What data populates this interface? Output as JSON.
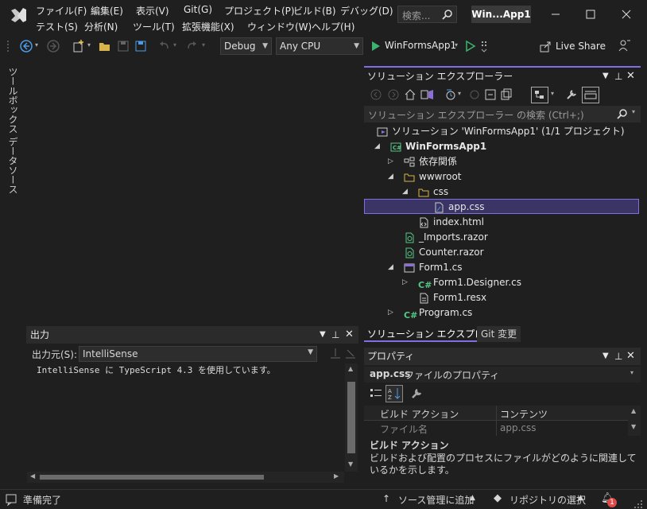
{
  "menu": {
    "row1": [
      "ファイル(F)",
      "編集(E)",
      "表示(V)",
      "Git(G)",
      "プロジェクト(P)",
      "ビルド(B)",
      "デバッグ(D)"
    ],
    "row2": [
      "テスト(S)",
      "分析(N)",
      "ツール(T)",
      "拡張機能(X)",
      "ウィンドウ(W)",
      "ヘルプ(H)"
    ]
  },
  "titlebar": {
    "search_placeholder": "検索...",
    "window_title": "Win...App1"
  },
  "toolbar": {
    "config": "Debug",
    "platform": "Any CPU",
    "run_target": "WinFormsApp1",
    "live_share": "Live Share"
  },
  "leftstrip": {
    "toolbox": "ツールボックス",
    "datasources": "データソース"
  },
  "solution_explorer": {
    "title": "ソリューション エクスプローラー",
    "search_placeholder": "ソリューション エクスプローラー の検索 (Ctrl+;)",
    "tree": [
      {
        "label": "ソリューション 'WinFormsApp1' (1/1 プロジェクト)",
        "icon": "solution-icon"
      },
      {
        "label": "WinFormsApp1",
        "icon": "csharp-project-icon"
      },
      {
        "label": "依存関係",
        "icon": "dependencies-icon"
      },
      {
        "label": "wwwroot",
        "icon": "folder-open-icon"
      },
      {
        "label": "css",
        "icon": "folder-open-icon"
      },
      {
        "label": "app.css",
        "icon": "css-file-icon"
      },
      {
        "label": "index.html",
        "icon": "html-file-icon"
      },
      {
        "label": "_Imports.razor",
        "icon": "razor-file-icon"
      },
      {
        "label": "Counter.razor",
        "icon": "razor-file-icon"
      },
      {
        "label": "Form1.cs",
        "icon": "form-icon"
      },
      {
        "label": "Form1.Designer.cs",
        "icon": "csharp-file-icon"
      },
      {
        "label": "Form1.resx",
        "icon": "resx-file-icon"
      },
      {
        "label": "Program.cs",
        "icon": "csharp-file-icon"
      }
    ],
    "tabs": [
      "ソリューション エクスプローラー",
      "Git 変更"
    ]
  },
  "output": {
    "title": "出力",
    "source_label": "出力元(S):",
    "source_value": "IntelliSense",
    "text": "IntelliSense に TypeScript 4.3 を使用しています。"
  },
  "properties": {
    "title": "プロパティ",
    "object_name": "app.css",
    "object_desc": "ファイルのプロパティ",
    "rows": [
      {
        "name": "ビルド アクション",
        "value": "コンテンツ"
      },
      {
        "name": "ファイル名",
        "value": "app.css"
      }
    ],
    "desc_title": "ビルド アクション",
    "desc_text": "ビルドおよび配置のプロセスにファイルがどのように関連しているかを示します。"
  },
  "statusbar": {
    "ready": "準備完了",
    "source_control": "ソース管理に追加",
    "repo": "リポジトリの選択",
    "notifications": "1"
  },
  "colors": {
    "accent": "#7f6fe0",
    "run_green": "#3cb371",
    "csharp_green": "#57c785",
    "background": "#1f1f1f"
  }
}
